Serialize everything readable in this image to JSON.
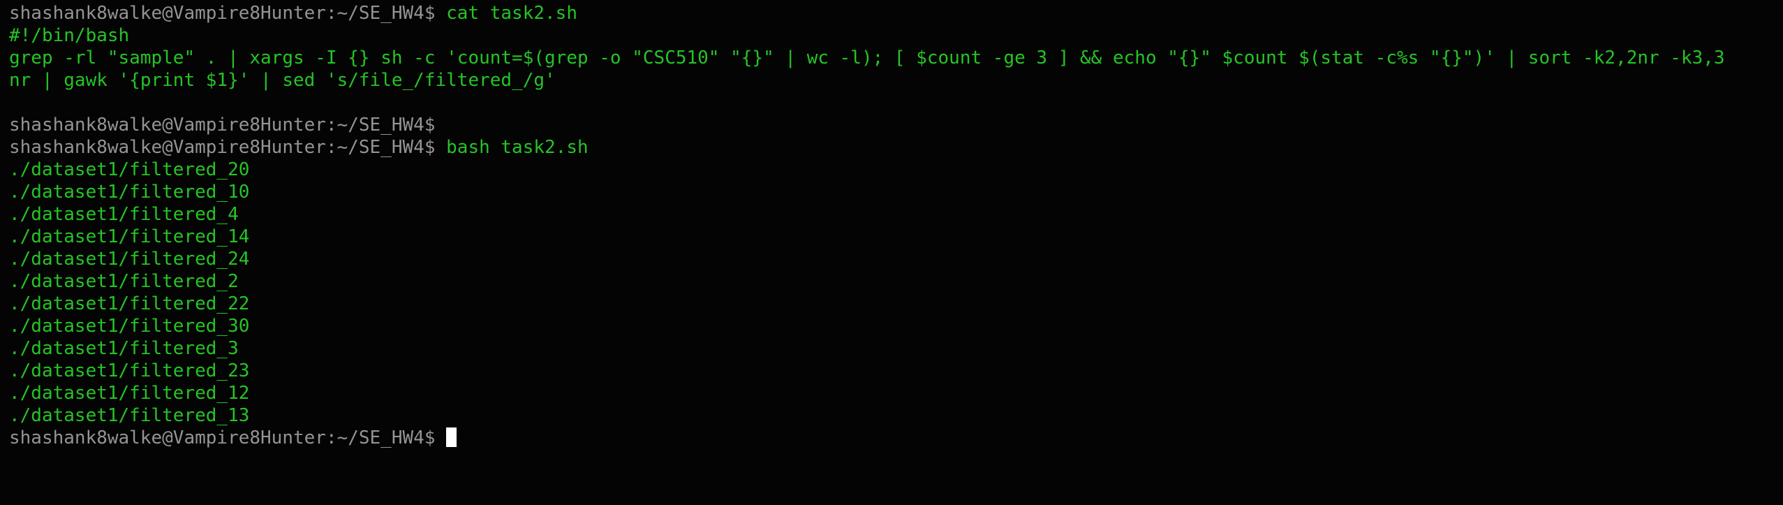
{
  "colors": {
    "background": "#040404",
    "prompt": "#949494",
    "text": "#25c425",
    "cursor": "#ffffff"
  },
  "prompt": "shashank8walke@Vampire8Hunter:~/SE_HW4$",
  "session": {
    "cmd1": "cat task2.sh",
    "file_shebang": "#!/bin/bash",
    "file_line1": "grep -rl \"sample\" . | xargs -I {} sh -c 'count=$(grep -o \"CSC510\" \"{}\" | wc -l); [ $count -ge 3 ] && echo \"{}\" $count $(stat -c%s \"{}\")' | sort -k2,2nr -k3,3",
    "file_line2": "nr | gawk '{print $1}' | sed 's/file_/filtered_/g'",
    "cmd3": "bash task2.sh",
    "output": [
      "./dataset1/filtered_20",
      "./dataset1/filtered_10",
      "./dataset1/filtered_4",
      "./dataset1/filtered_14",
      "./dataset1/filtered_24",
      "./dataset1/filtered_2",
      "./dataset1/filtered_22",
      "./dataset1/filtered_30",
      "./dataset1/filtered_3",
      "./dataset1/filtered_23",
      "./dataset1/filtered_12",
      "./dataset1/filtered_13"
    ]
  }
}
